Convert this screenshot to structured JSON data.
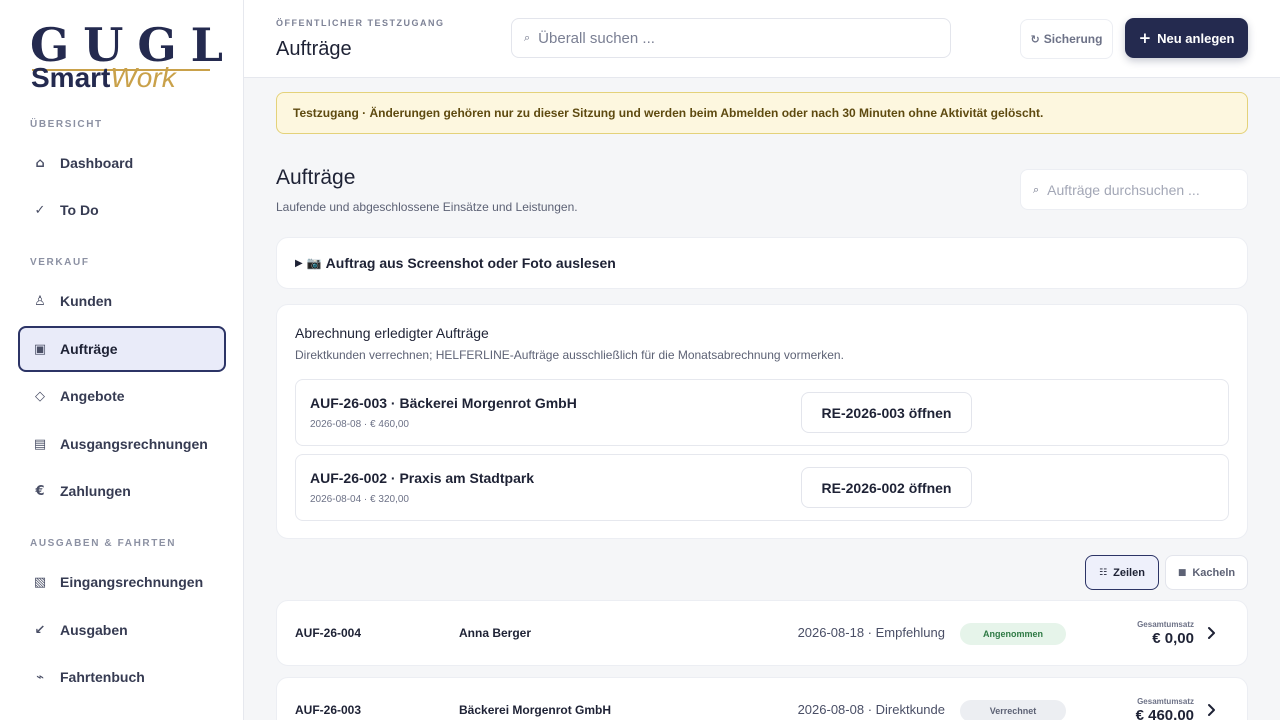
{
  "brand": {
    "logo_top": "GUGL",
    "logo_smart": "Smart",
    "logo_work": "Work"
  },
  "sidebar": {
    "sections": [
      {
        "label": "ÜBERSICHT"
      },
      {
        "label": "VERKAUF"
      },
      {
        "label": "AUSGABEN & FAHRTEN"
      }
    ],
    "items": [
      {
        "label": "Dashboard",
        "icon": "⌂"
      },
      {
        "label": "To Do",
        "icon": "✓"
      },
      {
        "label": "Kunden",
        "icon": "♙"
      },
      {
        "label": "Aufträge",
        "icon": "▣"
      },
      {
        "label": "Angebote",
        "icon": "◇"
      },
      {
        "label": "Ausgangsrechnungen",
        "icon": "▤"
      },
      {
        "label": "Zahlungen",
        "icon": "€"
      },
      {
        "label": "Eingangsrechnungen",
        "icon": "▧"
      },
      {
        "label": "Ausgaben",
        "icon": "↙"
      },
      {
        "label": "Fahrtenbuch",
        "icon": "⌁"
      }
    ],
    "active_item": "Aufträge"
  },
  "header": {
    "eyebrow": "ÖFFENTLICHER TESTZUGANG",
    "title": "Aufträge",
    "search_placeholder": "Überall suchen ...",
    "search_icon": "⌕",
    "backup_icon": "↻",
    "backup_label": "Sicherung",
    "new_icon": "+",
    "new_label": "Neu anlegen"
  },
  "banner": {
    "text": "Testzugang · Änderungen gehören nur zu dieser Sitzung und werden beim Abmelden oder nach 30 Minuten ohne Aktivität gelöscht."
  },
  "main": {
    "title": "Aufträge",
    "subtitle": "Laufende und abgeschlossene Einsätze und Leistungen.",
    "search_placeholder": "Aufträge durchsuchen ...",
    "screenshot_toggle_icon": "▶",
    "screenshot_camera_icon": "📷",
    "screenshot_label": "Auftrag aus Screenshot oder Foto auslesen"
  },
  "billing": {
    "title": "Abrechnung erledigter Aufträge",
    "subtitle": "Direktkunden verrechnen; HELFERLINE-Aufträge ausschließlich für die Monatsabrechnung vormerken.",
    "rows": [
      {
        "name": "AUF-26-003 · Bäckerei Morgenrot GmbH",
        "meta": "2026-08-08 · € 460,00",
        "button": "RE-2026-003 öffnen"
      },
      {
        "name": "AUF-26-002 · Praxis am Stadtpark",
        "meta": "2026-08-04 · € 320,00",
        "button": "RE-2026-002 öffnen"
      }
    ]
  },
  "view_toggle": {
    "rows_icon": "☷",
    "rows_label": "Zeilen",
    "tiles_icon": "■",
    "tiles_label": "Kacheln",
    "selected": "Zeilen"
  },
  "orders": [
    {
      "id": "AUF-26-004",
      "customer": "Anna Berger",
      "date_source": "2026-08-18 · Empfehlung",
      "status": "Angenommen",
      "total_label": "Gesamtumsatz",
      "total": "€ 0,00"
    },
    {
      "id": "AUF-26-003",
      "customer": "Bäckerei Morgenrot GmbH",
      "date_source": "2026-08-08 · Direktkunde",
      "status": "Verrechnet",
      "total_label": "Gesamtumsatz",
      "total": "€ 460,00"
    }
  ],
  "colors": {
    "brand_navy": "#242a4f",
    "brand_gold": "#c9a14a",
    "banner_bg": "#fdf7df",
    "accepted_green": "#2f7a45"
  }
}
